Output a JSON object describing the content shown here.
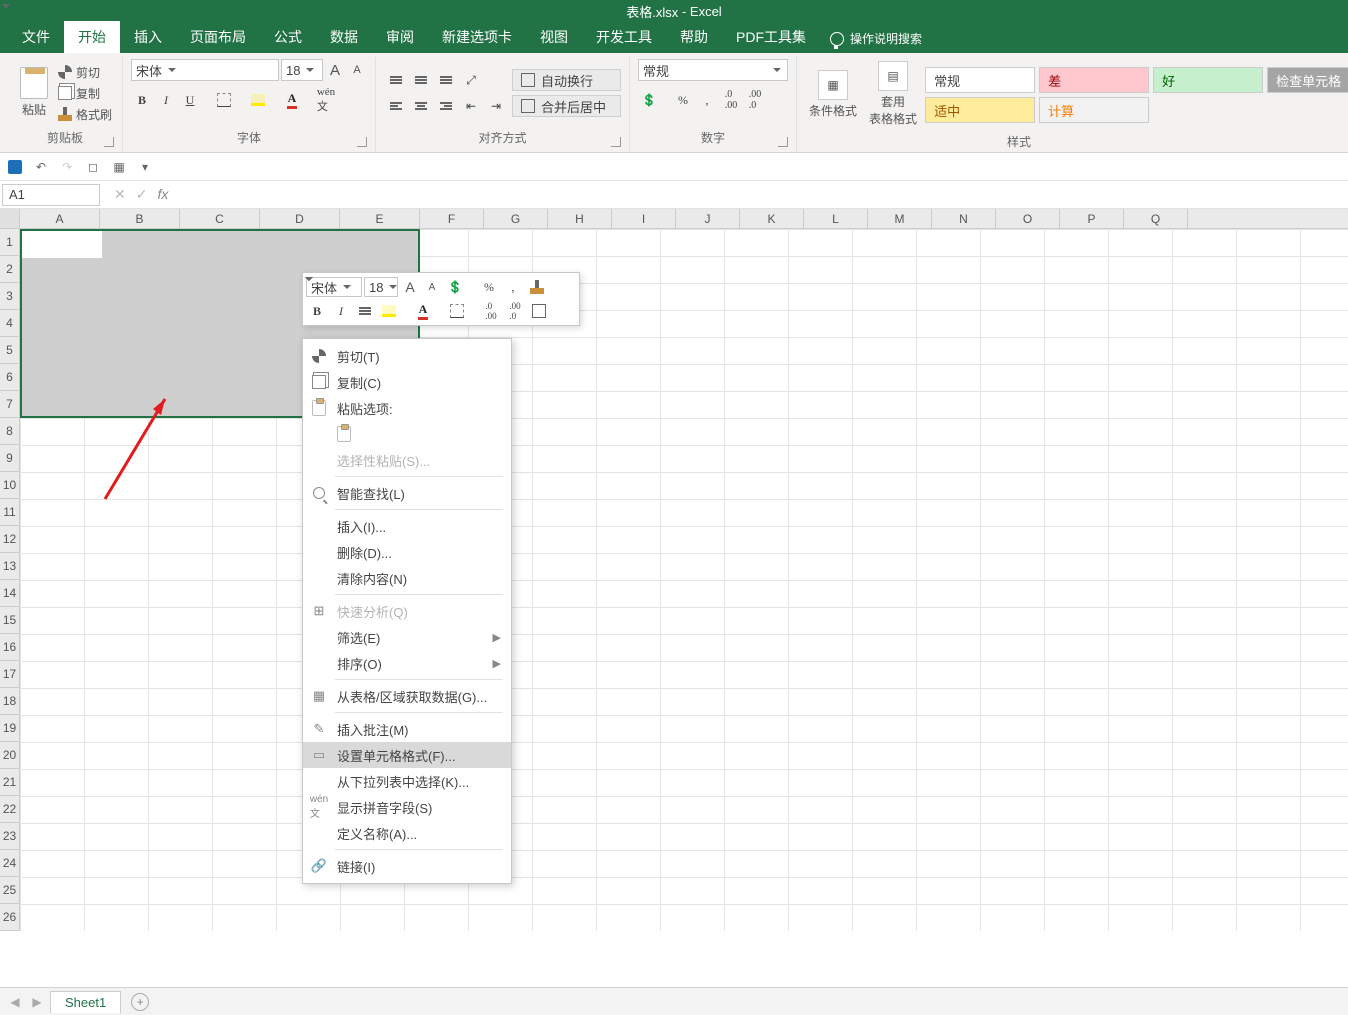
{
  "title": {
    "doc": "表格.xlsx",
    "sep": "-",
    "app": "Excel"
  },
  "tabs": [
    "文件",
    "开始",
    "插入",
    "页面布局",
    "公式",
    "数据",
    "审阅",
    "新建选项卡",
    "视图",
    "开发工具",
    "帮助",
    "PDF工具集"
  ],
  "tellme": "操作说明搜索",
  "clipboard": {
    "paste": "粘贴",
    "cut": "剪切",
    "copy": "复制",
    "painter": "格式刷",
    "group": "剪贴板"
  },
  "font": {
    "name": "宋体",
    "size": "18",
    "group": "字体",
    "A": "A",
    "a": "A"
  },
  "align": {
    "wrap": "自动换行",
    "merge": "合并后居中",
    "group": "对齐方式"
  },
  "number": {
    "format": "常规",
    "group": "数字"
  },
  "styles": {
    "cond": "条件格式",
    "table": "套用\n表格格式",
    "normal": "常规",
    "bad": "差",
    "good": "好",
    "neutral": "适中",
    "calc": "计算",
    "check": "检查单元格",
    "group": "样式"
  },
  "namebox": "A1",
  "fx": "fx",
  "columns": [
    "A",
    "B",
    "C",
    "D",
    "E",
    "F",
    "G",
    "H",
    "I",
    "J",
    "K",
    "L",
    "M",
    "N",
    "O",
    "P",
    "Q"
  ],
  "rows": [
    "1",
    "2",
    "3",
    "4",
    "5",
    "6",
    "7",
    "8",
    "9",
    "10",
    "11",
    "12",
    "13",
    "14",
    "15",
    "16",
    "17",
    "18",
    "19",
    "20",
    "21",
    "22",
    "23",
    "24",
    "25",
    "26"
  ],
  "minitb": {
    "font": "宋体",
    "size": "18",
    "pct": "%"
  },
  "ctx": {
    "cut": "剪切(T)",
    "copy": "复制(C)",
    "pasteopts": "粘贴选项:",
    "pastespecial": "选择性粘贴(S)...",
    "smartlookup": "智能查找(L)",
    "insert": "插入(I)...",
    "delete": "删除(D)...",
    "clear": "清除内容(N)",
    "quick": "快速分析(Q)",
    "filter": "筛选(E)",
    "sort": "排序(O)",
    "getdata": "从表格/区域获取数据(G)...",
    "comment": "插入批注(M)",
    "format": "设置单元格格式(F)...",
    "dropdown": "从下拉列表中选择(K)...",
    "phonetic": "显示拼音字段(S)",
    "name": "定义名称(A)...",
    "link": "链接(I)"
  },
  "sheet": {
    "name": "Sheet1"
  }
}
